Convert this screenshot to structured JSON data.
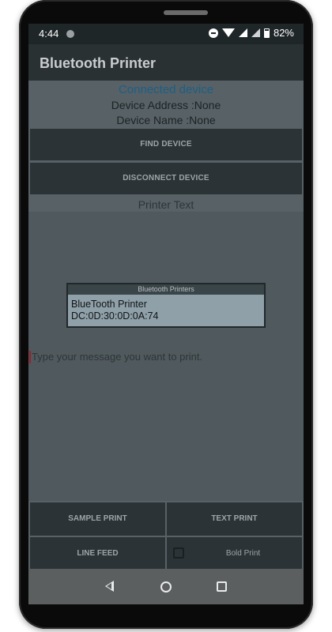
{
  "status_bar": {
    "time": "4:44",
    "battery": "82%"
  },
  "app_bar": {
    "title": "Bluetooth Printer"
  },
  "device_info": {
    "connected_label": "Connected device",
    "address_line": "Device Address :None",
    "name_line": "Device Name :None"
  },
  "buttons": {
    "find_device": "FIND DEVICE",
    "disconnect_device": "DISCONNECT DEVICE",
    "sample_print": "SAMPLE PRINT",
    "text_print": "TEXT PRINT",
    "line_feed": "LINE FEED",
    "bold_print": "Bold Print"
  },
  "printer_text": {
    "label": "Printer Text",
    "placeholder": "Type your message you want to print."
  },
  "dialog": {
    "title": "Bluetooth Printers",
    "items": [
      {
        "name": "BlueTooth Printer",
        "address": "DC:0D:30:0D:0A:74"
      }
    ]
  },
  "bold_checked": false
}
